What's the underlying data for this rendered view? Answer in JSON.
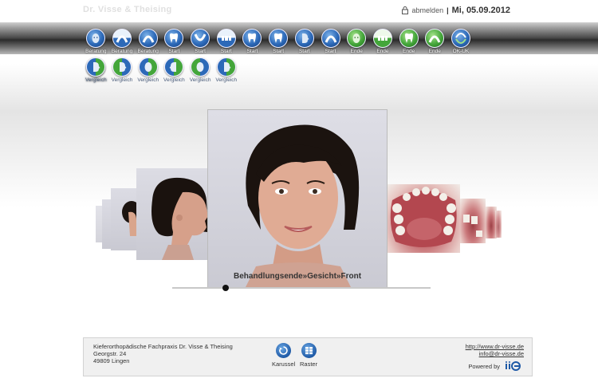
{
  "header": {
    "brand": "Dr. Visse & Theising",
    "logout_label": "abmelden",
    "separator": "|",
    "date": "Mi, 05.09.2012"
  },
  "colors": {
    "blue": "#2c69b8",
    "green": "#44a63a",
    "toolbar_dark": "#2b2b2b"
  },
  "icon_bar": {
    "row1": [
      {
        "label": "Beratung",
        "style": "blue",
        "icon": "face-front-icon"
      },
      {
        "label": "Beratung",
        "style": "half-blue",
        "icon": "upper-jaw-icon"
      },
      {
        "label": "Beratung",
        "style": "blue",
        "icon": "lower-jaw-icon"
      },
      {
        "label": "Start",
        "style": "blue",
        "icon": "tooth-icon"
      },
      {
        "label": "Start",
        "style": "blue",
        "icon": "lower-jaw-icon"
      },
      {
        "label": "Start",
        "style": "half-blue",
        "icon": "teeth-front-icon"
      },
      {
        "label": "Start",
        "style": "blue",
        "icon": "tooth-icon"
      },
      {
        "label": "Start",
        "style": "blue",
        "icon": "tooth-icon"
      },
      {
        "label": "Start",
        "style": "blue",
        "icon": "face-profile-icon"
      },
      {
        "label": "Start",
        "style": "blue",
        "icon": "upper-jaw-icon"
      },
      {
        "label": "Ende",
        "style": "green",
        "icon": "face-front-icon"
      },
      {
        "label": "Ende",
        "style": "half-green",
        "icon": "teeth-front-icon"
      },
      {
        "label": "Ende",
        "style": "green",
        "icon": "tooth-icon"
      },
      {
        "label": "Ende",
        "style": "green",
        "icon": "upper-jaw-icon"
      },
      {
        "label": "OK-UK",
        "style": "blue",
        "icon": "jaws-icon"
      },
      {
        "label": "Vergleich",
        "style": "blue",
        "icon": "tooth-icon"
      }
    ],
    "row2": [
      {
        "label": "Vergleich",
        "style": "blue",
        "icon": "face-compare-icon"
      },
      {
        "label": "Vergleich",
        "style": "green",
        "icon": "face-compare-icon"
      },
      {
        "label": "Vergleich",
        "style": "blue",
        "icon": "face-compare-icon"
      },
      {
        "label": "Vergleich",
        "style": "blue",
        "icon": "face-compare-icon"
      },
      {
        "label": "Vergleich",
        "style": "green",
        "icon": "face-compare-icon"
      },
      {
        "label": "Vergleich",
        "style": "blue",
        "icon": "face-compare-icon"
      }
    ]
  },
  "carousel": {
    "caption": "Behandlungsende»Gesicht»Front",
    "slides_left": [
      "face-profile-photo",
      "face-profile-photo",
      "face-profile-photo",
      "face-profile-photo"
    ],
    "slides_right": [
      "lower-jaw-photo",
      "teeth-photo",
      "teeth-photo",
      "teeth-photo"
    ]
  },
  "footer": {
    "practice_name": "Kieferorthopädische Fachpraxis Dr. Visse & Theising",
    "street": "Georgstr. 24",
    "city": "49809 Lingen",
    "carousel_button": "Karussel",
    "grid_button": "Raster",
    "website": "http://www.dr-visse.de",
    "email": "info@dr-visse.de",
    "powered_by": "Powered by"
  }
}
